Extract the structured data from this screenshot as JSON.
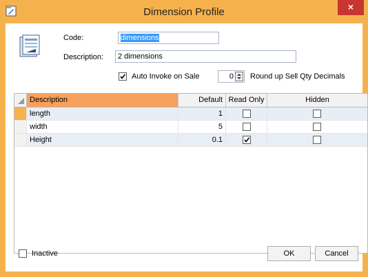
{
  "window": {
    "title": "Dimension Profile",
    "close_label": "×"
  },
  "form": {
    "code_label": "Code:",
    "code_value": "dimensions",
    "description_label": "Description:",
    "description_value": "2 dimensions",
    "auto_invoke_label": "Auto Invoke on Sale",
    "auto_invoke_checked": true,
    "round_up_value": "0",
    "round_up_label": "Round up Sell Qty Decimals"
  },
  "grid": {
    "columns": [
      "Description",
      "Default Value",
      "Read Only",
      "Hidden"
    ],
    "rows": [
      {
        "description": "length",
        "default_value": "1",
        "read_only": false,
        "hidden": false
      },
      {
        "description": "width",
        "default_value": "5",
        "read_only": false,
        "hidden": false
      },
      {
        "description": "Height",
        "default_value": "0.1",
        "read_only": true,
        "hidden": false
      }
    ]
  },
  "footer": {
    "inactive_label": "Inactive",
    "inactive_checked": false,
    "ok_label": "OK",
    "cancel_label": "Cancel"
  },
  "colors": {
    "accent": "#f5b24c",
    "close": "#c7362f",
    "selected_header": "#f5a25c"
  }
}
